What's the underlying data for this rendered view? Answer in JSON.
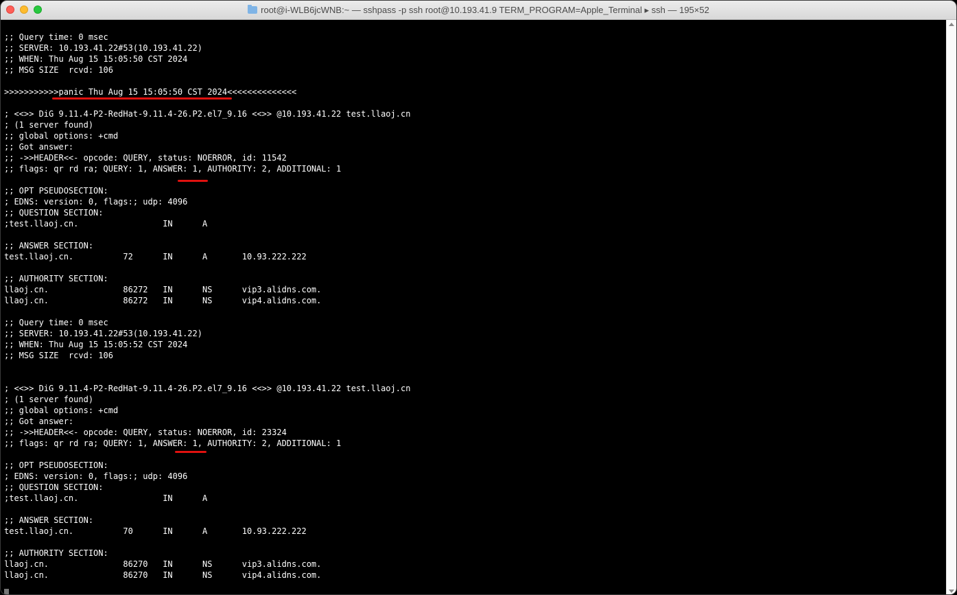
{
  "window": {
    "title": "root@i-WLB6jcWNB:~ — sshpass -p ssh root@10.193.41.9 TERM_PROGRAM=Apple_Terminal ▸ ssh — 195×52"
  },
  "terminal": {
    "lines": [
      ";; Query time: 0 msec",
      ";; SERVER: 10.193.41.22#53(10.193.41.22)",
      ";; WHEN: Thu Aug 15 15:05:50 CST 2024",
      ";; MSG SIZE  rcvd: 106",
      "",
      ">>>>>>>>>>>panic Thu Aug 15 15:05:50 CST 2024<<<<<<<<<<<<<<",
      "",
      "; <<>> DiG 9.11.4-P2-RedHat-9.11.4-26.P2.el7_9.16 <<>> @10.193.41.22 test.llaoj.cn",
      "; (1 server found)",
      ";; global options: +cmd",
      ";; Got answer:",
      ";; ->>HEADER<<- opcode: QUERY, status: NOERROR, id: 11542",
      ";; flags: qr rd ra; QUERY: 1, ANSWER: 1, AUTHORITY: 2, ADDITIONAL: 1",
      "",
      ";; OPT PSEUDOSECTION:",
      "; EDNS: version: 0, flags:; udp: 4096",
      ";; QUESTION SECTION:",
      ";test.llaoj.cn.                 IN      A",
      "",
      ";; ANSWER SECTION:",
      "test.llaoj.cn.          72      IN      A       10.93.222.222",
      "",
      ";; AUTHORITY SECTION:",
      "llaoj.cn.               86272   IN      NS      vip3.alidns.com.",
      "llaoj.cn.               86272   IN      NS      vip4.alidns.com.",
      "",
      ";; Query time: 0 msec",
      ";; SERVER: 10.193.41.22#53(10.193.41.22)",
      ";; WHEN: Thu Aug 15 15:05:52 CST 2024",
      ";; MSG SIZE  rcvd: 106",
      "",
      "",
      "; <<>> DiG 9.11.4-P2-RedHat-9.11.4-26.P2.el7_9.16 <<>> @10.193.41.22 test.llaoj.cn",
      "; (1 server found)",
      ";; global options: +cmd",
      ";; Got answer:",
      ";; ->>HEADER<<- opcode: QUERY, status: NOERROR, id: 23324",
      ";; flags: qr rd ra; QUERY: 1, ANSWER: 1, AUTHORITY: 2, ADDITIONAL: 1",
      "",
      ";; OPT PSEUDOSECTION:",
      "; EDNS: version: 0, flags:; udp: 4096",
      ";; QUESTION SECTION:",
      ";test.llaoj.cn.                 IN      A",
      "",
      ";; ANSWER SECTION:",
      "test.llaoj.cn.          70      IN      A       10.93.222.222",
      "",
      ";; AUTHORITY SECTION:",
      "llaoj.cn.               86270   IN      NS      vip3.alidns.com.",
      "llaoj.cn.               86270   IN      NS      vip4.alidns.com."
    ]
  },
  "annotation_color": "#e0110f"
}
